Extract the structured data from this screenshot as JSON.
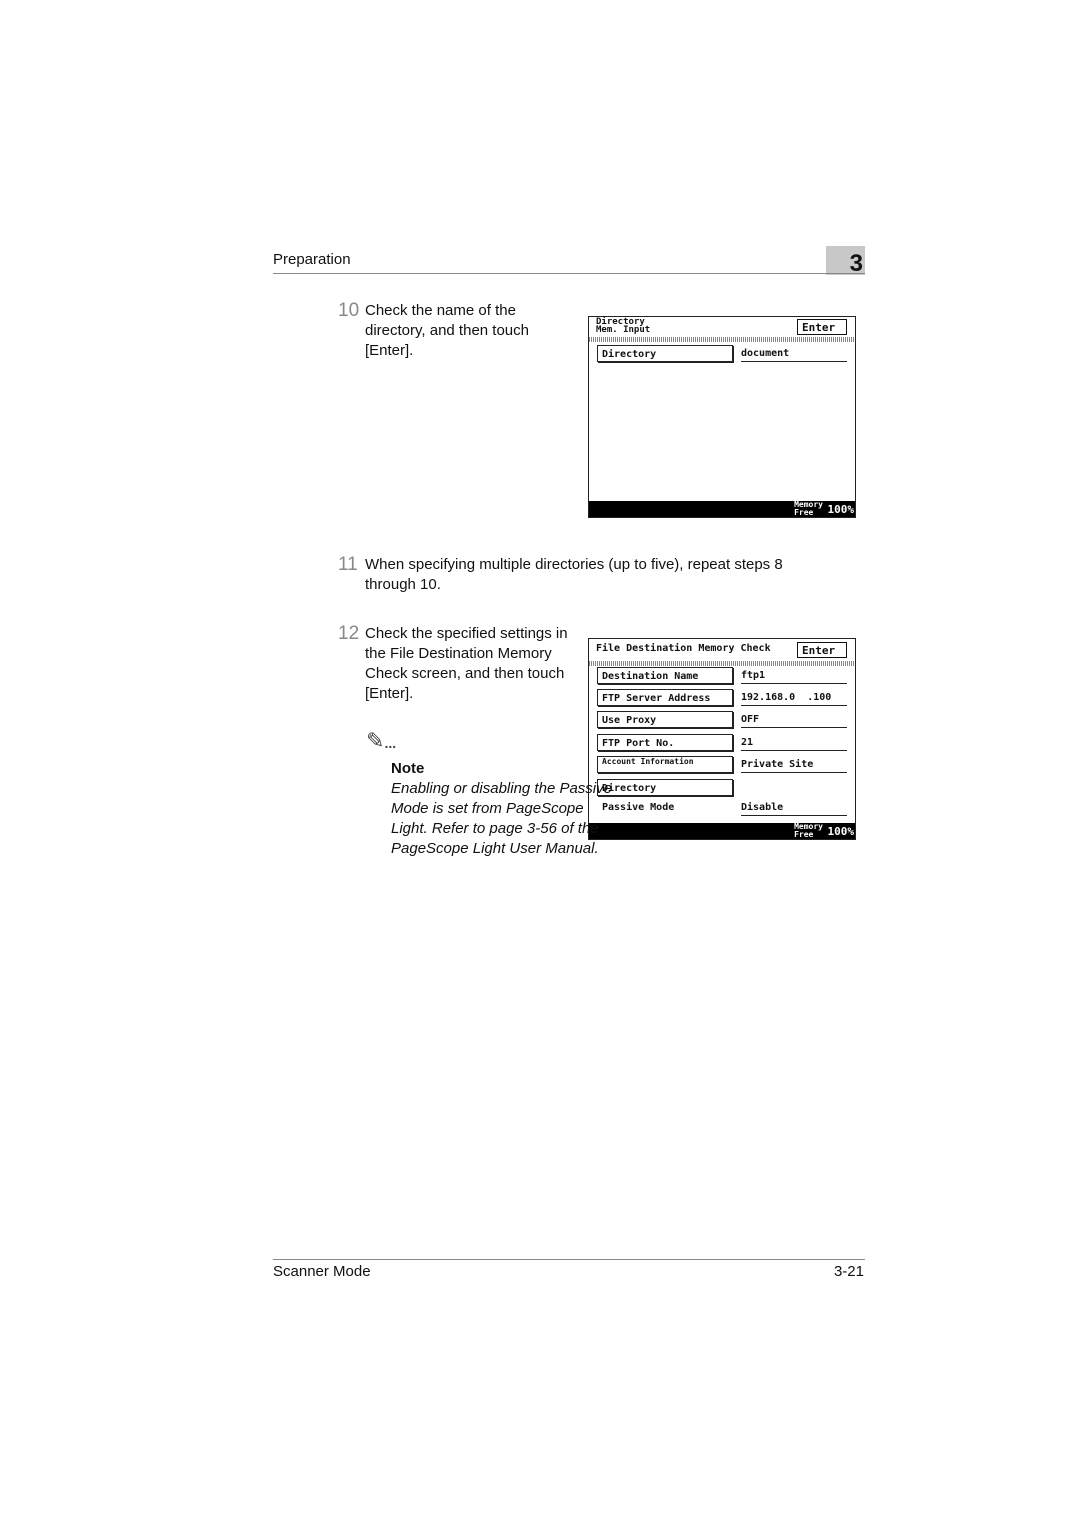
{
  "header": {
    "section": "Preparation",
    "chapter": "3"
  },
  "steps": [
    {
      "num": "10",
      "text": "Check the name of the directory, and then touch [Enter]."
    },
    {
      "num": "11",
      "text": "When specifying multiple directories (up to five), repeat steps 8 through 10."
    },
    {
      "num": "12",
      "text": "Check the specified settings in the File Destination Memory Check screen, and then touch [Enter]."
    }
  ],
  "screen1": {
    "title1": "Directory",
    "title2": "Mem. Input",
    "enter": "Enter",
    "button": "Directory",
    "value": "document",
    "memory1": "Memory",
    "memory2": "Free",
    "percent": "100%"
  },
  "screen2": {
    "title": "File Destination Memory Check",
    "enter": "Enter",
    "rows": [
      {
        "label": "Destination Name",
        "value": "ftp1"
      },
      {
        "label": "FTP Server Address",
        "value": "192.168.0  .100"
      },
      {
        "label": "Use Proxy",
        "value": "OFF"
      },
      {
        "label": "FTP Port No.",
        "value": "21"
      },
      {
        "label": "Account Information",
        "value": "Private Site"
      },
      {
        "label": "Directory",
        "value": ""
      }
    ],
    "passive_label": "Passive Mode",
    "passive_value": "Disable",
    "memory1": "Memory",
    "memory2": "Free",
    "percent": "100%"
  },
  "note": {
    "icon": "pencil-note-icon",
    "title": "Note",
    "text": "Enabling or disabling the Passive Mode is set from PageScope Light. Refer to page 3-56 of the PageScope Light User Manual."
  },
  "footer": {
    "left": "Scanner Mode",
    "right": "3-21"
  }
}
